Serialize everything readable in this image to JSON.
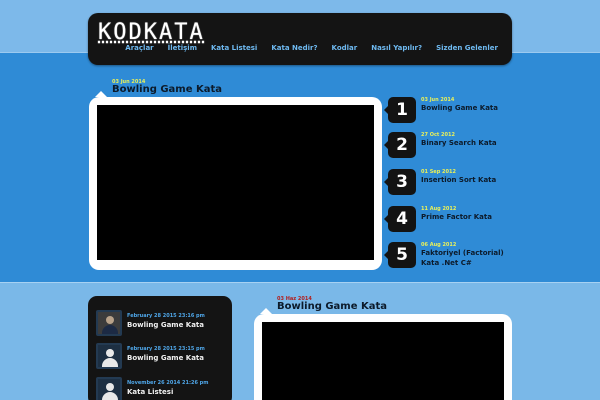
{
  "site": {
    "logo": "KODKATA"
  },
  "nav": [
    {
      "label": "Araçlar"
    },
    {
      "label": "İletişim"
    },
    {
      "label": "Kata Listesi"
    },
    {
      "label": "Kata Nedir?"
    },
    {
      "label": "Kodlar"
    },
    {
      "label": "Nasıl Yapılır?"
    },
    {
      "label": "Sizden Gelenler"
    }
  ],
  "featured": {
    "date": "03 Jun 2014",
    "title": "Bowling Game Kata"
  },
  "top_list": [
    {
      "number": "1",
      "date": "03 Jun 2014",
      "title": "Bowling Game Kata"
    },
    {
      "number": "2",
      "date": "27 Oct 2012",
      "title": "Binary Search Kata"
    },
    {
      "number": "3",
      "date": "01 Sep 2012",
      "title": "Insertion Sort Kata"
    },
    {
      "number": "4",
      "date": "11 Aug 2012",
      "title": "Prime Factor Kata"
    },
    {
      "number": "5",
      "date": "06 Aug 2012",
      "title": "Faktoriyel (Factorial) Kata .Net C#"
    }
  ],
  "comments": [
    {
      "date": "February 28 2015 23:16 pm",
      "title": "Bowling Game Kata",
      "avatar": "user-photo-icon"
    },
    {
      "date": "February 28 2015 23:15 pm",
      "title": "Bowling Game Kata",
      "avatar": "default-user-icon"
    },
    {
      "date": "November 26 2014 21:26 pm",
      "title": "Kata Listesi",
      "avatar": "default-user-icon"
    }
  ],
  "post2": {
    "date": "03 Haz 2014",
    "title": "Bowling Game Kata"
  },
  "colors": {
    "background_light": "#7ab8e8",
    "hero_blue": "#2f8bd6",
    "panel_dark": "#141414",
    "nav_link": "#6eb9f0",
    "date_yellow": "#e9f05a",
    "date_red": "#b02020"
  }
}
